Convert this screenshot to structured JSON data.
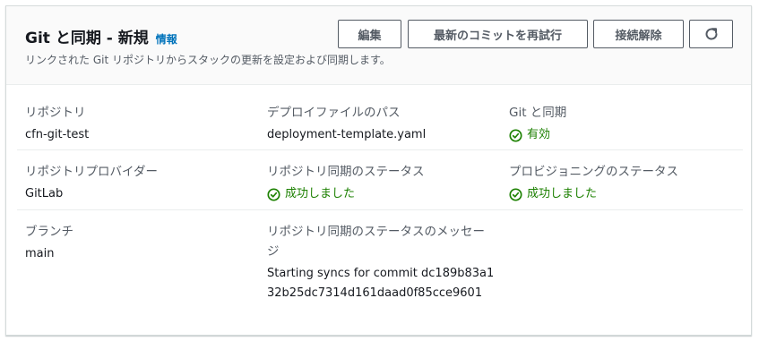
{
  "header": {
    "title": "Git と同期 - 新規",
    "info_link": "情報",
    "description": "リンクされた Git リポジトリからスタックの更新を設定および同期します。"
  },
  "actions": {
    "edit": "編集",
    "retry_latest_commit": "最新のコミットを再試行",
    "disconnect": "接続解除",
    "refresh_icon": "refresh-icon"
  },
  "details": {
    "repository": {
      "label": "リポジトリ",
      "value": "cfn-git-test"
    },
    "deployment_file_path": {
      "label": "デプロイファイルのパス",
      "value": "deployment-template.yaml"
    },
    "git_sync": {
      "label": "Git と同期",
      "value": "有効"
    },
    "repository_provider": {
      "label": "リポジトリプロバイダー",
      "value": "GitLab"
    },
    "repository_sync_status": {
      "label": "リポジトリ同期のステータス",
      "value": "成功しました"
    },
    "provisioning_status": {
      "label": "プロビジョニングのステータス",
      "value": "成功しました"
    },
    "branch": {
      "label": "ブランチ",
      "value": "main"
    },
    "repository_sync_message": {
      "label": "リポジトリ同期のステータスのメッセージ",
      "value": "Starting syncs for commit dc189b83a132b25dc7314d161daad0f85cce9601"
    }
  },
  "colors": {
    "success": "#1d8102",
    "link": "#0073bb",
    "secondary_text": "#545b64"
  }
}
